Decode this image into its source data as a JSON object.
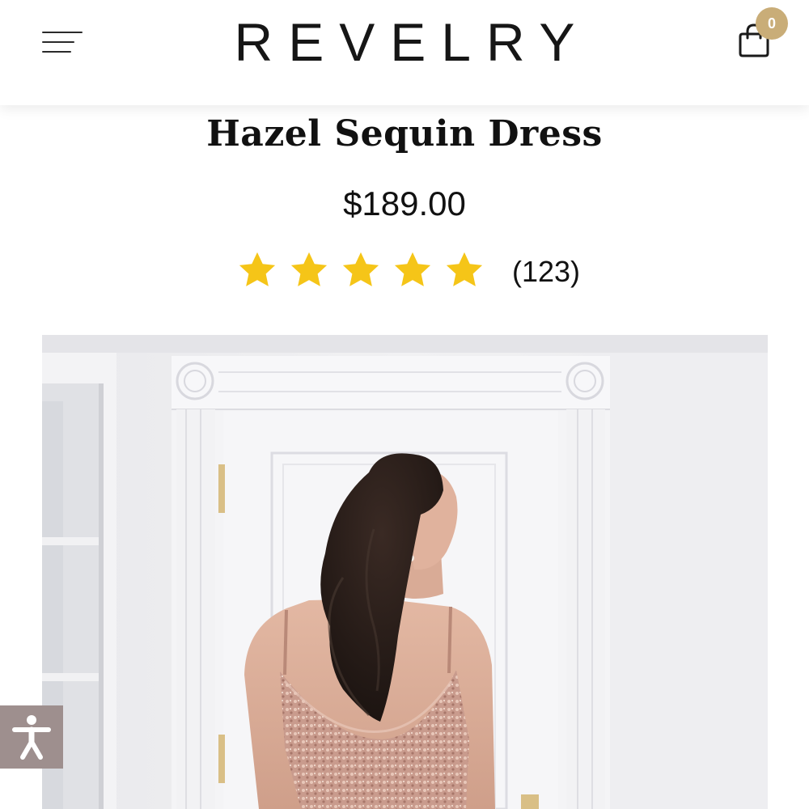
{
  "header": {
    "logo": "REVELRY",
    "cart_count": "0"
  },
  "product": {
    "title": "Hazel Sequin Dress",
    "price": "$189.00",
    "rating": 5,
    "rating_max": 5,
    "review_count": "(123)"
  },
  "colors": {
    "star": "#f5c518",
    "cart_badge": "#c9ad78",
    "accessibility_button": "#9e8f8e",
    "dress": "#c79c8f"
  },
  "icons": {
    "menu": "hamburger-menu-icon",
    "cart": "shopping-bag-icon",
    "star": "star-icon",
    "accessibility": "accessibility-icon"
  }
}
